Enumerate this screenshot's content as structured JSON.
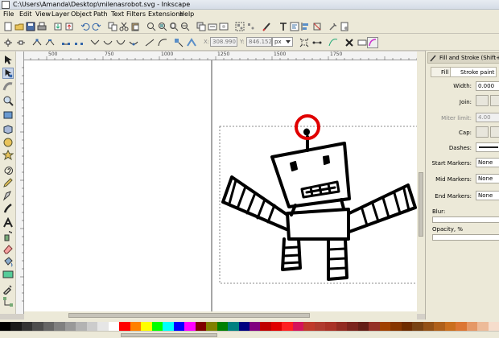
{
  "window": {
    "title": "C:\\Users\\Amanda\\Desktop\\milenasrobot.svg - Inkscape"
  },
  "menu": {
    "items": [
      {
        "label": "File"
      },
      {
        "label": "Edit"
      },
      {
        "label": "View"
      },
      {
        "label": "Layer"
      },
      {
        "label": "Object"
      },
      {
        "label": "Path"
      },
      {
        "label": "Text"
      },
      {
        "label": "Filters"
      },
      {
        "label": "Extensions"
      },
      {
        "label": "Help"
      }
    ]
  },
  "controls": {
    "x_label": "X:",
    "x_value": "308.990",
    "y_label": "Y:",
    "y_value": "846.152",
    "unit": "px"
  },
  "ruler": {
    "labels": [
      "500",
      "750",
      "1000",
      "1250",
      "1500",
      "1750"
    ]
  },
  "dock": {
    "header": "Fill and Stroke (Shift+Ctrl+F)",
    "tabs": [
      {
        "label": "Fill"
      },
      {
        "label": "Stroke paint"
      }
    ],
    "width_label": "Width:",
    "width_value": "0.000",
    "join_label": "Join:",
    "miter_label": "Miter limit:",
    "miter_value": "4.00",
    "cap_label": "Cap:",
    "dashes_label": "Dashes:",
    "start_markers_label": "Start Markers:",
    "start_markers_value": "None",
    "mid_markers_label": "Mid Markers:",
    "mid_markers_value": "None",
    "end_markers_label": "End Markers:",
    "end_markers_value": "None",
    "blur_label": "Blur:",
    "opacity_label": "Opacity, %"
  },
  "palette": {
    "colors": [
      "#000000",
      "#1a1a1a",
      "#333333",
      "#4d4d4d",
      "#666666",
      "#808080",
      "#999999",
      "#b3b3b3",
      "#cccccc",
      "#e6e6e6",
      "#ffffff",
      "#ff0000",
      "#ff8000",
      "#ffff00",
      "#00ff00",
      "#00ffff",
      "#0000ff",
      "#ff00ff",
      "#800000",
      "#808000",
      "#008000",
      "#008080",
      "#000080",
      "#800080",
      "#c00000",
      "#e00000",
      "#ff2020",
      "#d4145a",
      "#c0392b",
      "#b03a2e",
      "#a93226",
      "#922b21",
      "#7b241c",
      "#641e16",
      "#943126",
      "#a04000",
      "#873600",
      "#6e2c00",
      "#784212",
      "#935116",
      "#af601a",
      "#ca6f1e",
      "#dc7633",
      "#e59866",
      "#edbb99",
      "#f6ddcc"
    ]
  }
}
